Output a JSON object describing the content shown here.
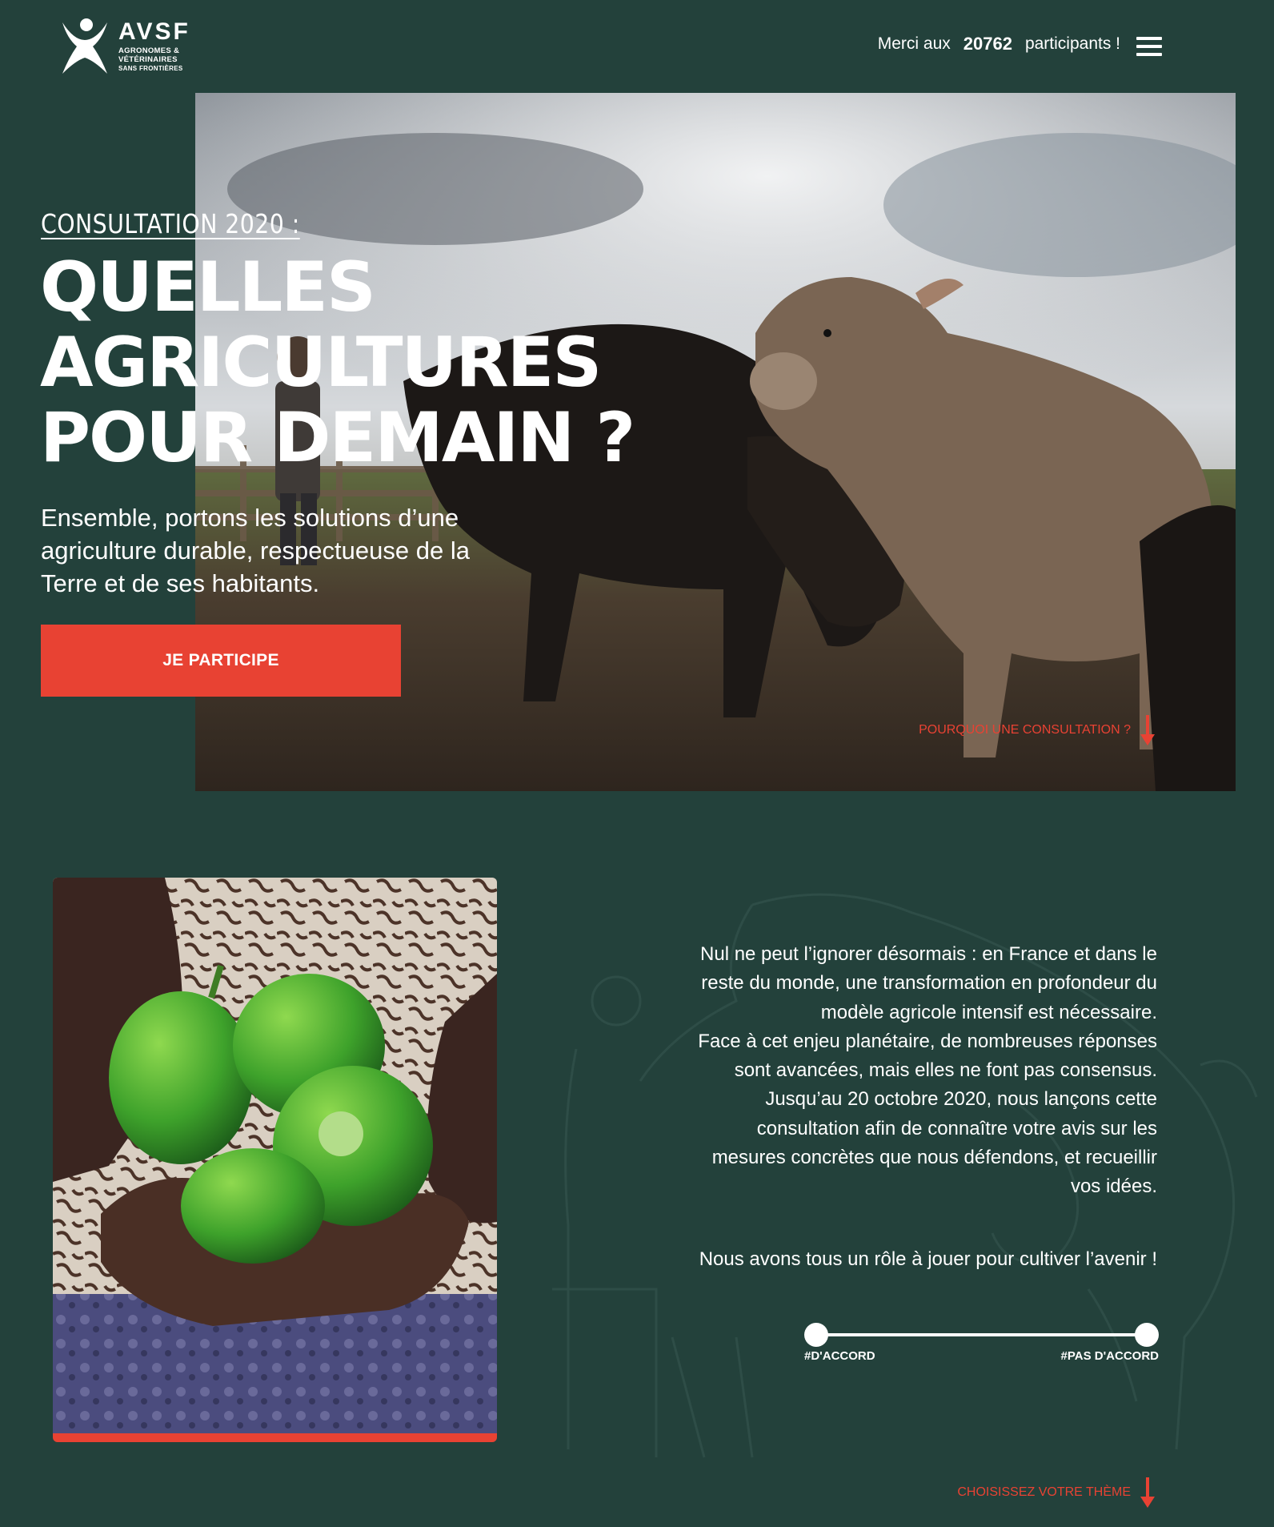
{
  "header": {
    "logo": {
      "name": "AVSF",
      "subtitle_line1": "AGRONOMES &",
      "subtitle_line2": "VÉTÉRINAIRES",
      "subtitle_line3": "SANS FRONTIÈRES"
    },
    "thanks_prefix": "Merci aux",
    "participant_count": "20762",
    "thanks_suffix": "participants !",
    "menu_icon": "hamburger-menu-icon"
  },
  "hero": {
    "eyebrow": "CONSULTATION 2020 :",
    "title_lines": [
      "QUELLES",
      "AGRICULTURES",
      "POUR DEMAIN ?"
    ],
    "description": "Ensemble, portons les solutions d’une agriculture durable, respectueuse de la Terre et de ses habitants.",
    "cta_label": "JE PARTICIPE",
    "scroll_link": "POURQUOI UNE CONSULTATION ?"
  },
  "intro": {
    "paragraph_lines": [
      "Nul ne peut l’ignorer désormais : en France et dans le",
      "reste du monde, une transformation en profondeur du",
      "modèle agricole intensif est nécessaire.",
      "Face à cet enjeu planétaire, de nombreuses réponses",
      "sont avancées, mais elles ne font pas consensus.",
      "Jusqu’au 20 octobre 2020, nous lançons cette",
      "consultation afin de connaître votre avis sur les",
      "mesures concrètes que nous défendons, et recueillir",
      "vos idées."
    ],
    "tagline": "Nous avons tous un rôle à jouer pour cultiver l’avenir !"
  },
  "slider": {
    "left_label": "#D'ACCORD",
    "right_label": "#PAS D'ACCORD"
  },
  "bottom_link": "CHOISISSEZ VOTRE THÈME",
  "colors": {
    "background": "#23413b",
    "accent": "#e84233",
    "text": "#ffffff"
  }
}
